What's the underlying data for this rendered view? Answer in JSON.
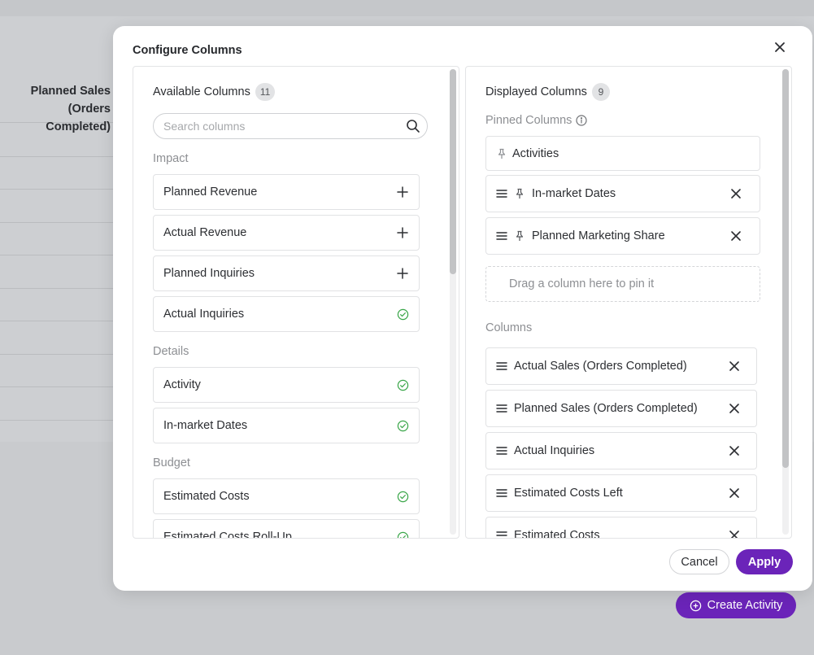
{
  "background": {
    "table_header": [
      "Planned Sales",
      "(Orders Completed)"
    ],
    "create_button_label": "Create Activity"
  },
  "modal": {
    "title": "Configure Columns",
    "available": {
      "title": "Available Columns",
      "count": "11",
      "search_placeholder": "Search columns",
      "groups": [
        {
          "label": "Impact",
          "items": [
            {
              "label": "Planned Revenue",
              "state": "add"
            },
            {
              "label": "Actual Revenue",
              "state": "add"
            },
            {
              "label": "Planned Inquiries",
              "state": "add"
            },
            {
              "label": "Actual Inquiries",
              "state": "added"
            }
          ]
        },
        {
          "label": "Details",
          "items": [
            {
              "label": "Activity",
              "state": "added"
            },
            {
              "label": "In-market Dates",
              "state": "added"
            }
          ]
        },
        {
          "label": "Budget",
          "items": [
            {
              "label": "Estimated Costs",
              "state": "added"
            },
            {
              "label": "Estimated Costs Roll-Up",
              "state": "added"
            }
          ]
        }
      ]
    },
    "displayed": {
      "title": "Displayed Columns",
      "count": "9",
      "pinned_label": "Pinned Columns",
      "pinned": [
        {
          "label": "Activities",
          "locked": true
        },
        {
          "label": "In-market Dates",
          "locked": false
        },
        {
          "label": "Planned Marketing Share",
          "locked": false
        }
      ],
      "drop_hint": "Drag a column here to pin it",
      "columns_label": "Columns",
      "columns": [
        {
          "label": "Actual Sales (Orders Completed)"
        },
        {
          "label": "Planned Sales (Orders Completed)"
        },
        {
          "label": "Actual Inquiries"
        },
        {
          "label": "Estimated Costs Left"
        },
        {
          "label": "Estimated Costs"
        }
      ]
    },
    "cancel_label": "Cancel",
    "apply_label": "Apply"
  },
  "colors": {
    "accent": "#6b24b9",
    "success": "#3aa649",
    "overlay": "#c9cbce"
  }
}
